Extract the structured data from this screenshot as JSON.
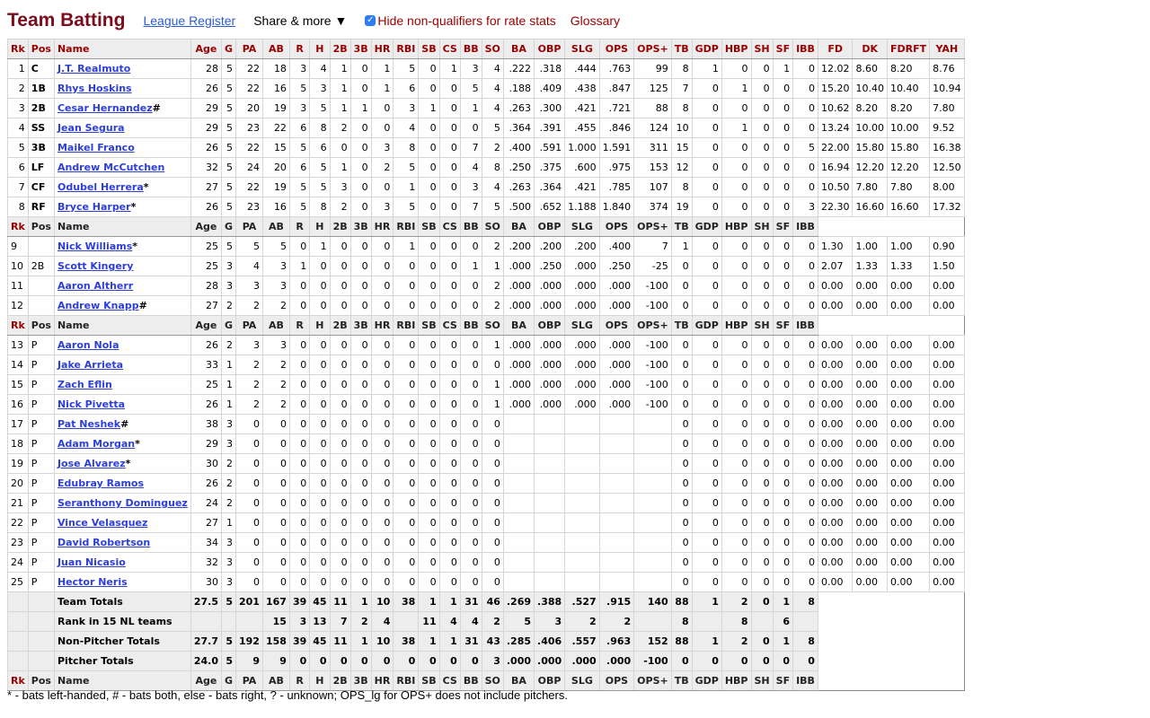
{
  "header": {
    "title": "Team Batting",
    "league_register": "League Register",
    "share_more": "Share & more ▼",
    "hide_nonqualifiers_label": "Hide non-qualifiers for rate stats",
    "hide_nonqualifiers_checked": true,
    "glossary": "Glossary"
  },
  "columns": [
    "Rk",
    "Pos",
    "Name",
    "Age",
    "G",
    "PA",
    "AB",
    "R",
    "H",
    "2B",
    "3B",
    "HR",
    "RBI",
    "SB",
    "CS",
    "BB",
    "SO",
    "BA",
    "OBP",
    "SLG",
    "OPS",
    "OPS+",
    "TB",
    "GDP",
    "HBP",
    "SH",
    "SF",
    "IBB",
    "FD",
    "DK",
    "FDRFT",
    "YAH"
  ],
  "starters": [
    {
      "rk": "1",
      "pos": "C",
      "name": "J.T. Realmuto",
      "mark": "",
      "stats": [
        "28",
        "5",
        "22",
        "18",
        "3",
        "4",
        "1",
        "0",
        "1",
        "5",
        "0",
        "1",
        "3",
        "4",
        ".222",
        ".318",
        ".444",
        ".763",
        "99",
        "8",
        "1",
        "0",
        "0",
        "1",
        "0"
      ],
      "fantasy": [
        "12.02",
        "8.60",
        "8.20",
        "8.76"
      ]
    },
    {
      "rk": "2",
      "pos": "1B",
      "name": "Rhys Hoskins",
      "mark": "",
      "stats": [
        "26",
        "5",
        "22",
        "16",
        "5",
        "3",
        "1",
        "0",
        "1",
        "6",
        "0",
        "0",
        "5",
        "4",
        ".188",
        ".409",
        ".438",
        ".847",
        "125",
        "7",
        "0",
        "1",
        "0",
        "0",
        "0"
      ],
      "fantasy": [
        "15.20",
        "10.40",
        "10.40",
        "10.94"
      ]
    },
    {
      "rk": "3",
      "pos": "2B",
      "name": "Cesar Hernandez",
      "mark": "#",
      "stats": [
        "29",
        "5",
        "20",
        "19",
        "3",
        "5",
        "1",
        "1",
        "0",
        "3",
        "1",
        "0",
        "1",
        "4",
        ".263",
        ".300",
        ".421",
        ".721",
        "88",
        "8",
        "0",
        "0",
        "0",
        "0",
        "0"
      ],
      "fantasy": [
        "10.62",
        "8.20",
        "8.20",
        "7.80"
      ]
    },
    {
      "rk": "4",
      "pos": "SS",
      "name": "Jean Segura",
      "mark": "",
      "stats": [
        "29",
        "5",
        "23",
        "22",
        "6",
        "8",
        "2",
        "0",
        "0",
        "4",
        "0",
        "0",
        "0",
        "5",
        ".364",
        ".391",
        ".455",
        ".846",
        "124",
        "10",
        "0",
        "1",
        "0",
        "0",
        "0"
      ],
      "fantasy": [
        "13.24",
        "10.00",
        "10.00",
        "9.52"
      ]
    },
    {
      "rk": "5",
      "pos": "3B",
      "name": "Maikel Franco",
      "mark": "",
      "stats": [
        "26",
        "5",
        "22",
        "15",
        "5",
        "6",
        "0",
        "0",
        "3",
        "8",
        "0",
        "0",
        "7",
        "2",
        ".400",
        ".591",
        "1.000",
        "1.591",
        "311",
        "15",
        "0",
        "0",
        "0",
        "0",
        "5"
      ],
      "fantasy": [
        "22.00",
        "15.80",
        "15.80",
        "16.38"
      ]
    },
    {
      "rk": "6",
      "pos": "LF",
      "name": "Andrew McCutchen",
      "mark": "",
      "stats": [
        "32",
        "5",
        "24",
        "20",
        "6",
        "5",
        "1",
        "0",
        "2",
        "5",
        "0",
        "0",
        "4",
        "8",
        ".250",
        ".375",
        ".600",
        ".975",
        "153",
        "12",
        "0",
        "0",
        "0",
        "0",
        "0"
      ],
      "fantasy": [
        "16.94",
        "12.20",
        "12.20",
        "12.50"
      ]
    },
    {
      "rk": "7",
      "pos": "CF",
      "name": "Odubel Herrera",
      "mark": "*",
      "stats": [
        "27",
        "5",
        "22",
        "19",
        "5",
        "5",
        "3",
        "0",
        "0",
        "1",
        "0",
        "0",
        "3",
        "4",
        ".263",
        ".364",
        ".421",
        ".785",
        "107",
        "8",
        "0",
        "0",
        "0",
        "0",
        "0"
      ],
      "fantasy": [
        "10.50",
        "7.80",
        "7.80",
        "8.00"
      ]
    },
    {
      "rk": "8",
      "pos": "RF",
      "name": "Bryce Harper",
      "mark": "*",
      "stats": [
        "26",
        "5",
        "23",
        "16",
        "5",
        "8",
        "2",
        "0",
        "3",
        "5",
        "0",
        "0",
        "7",
        "5",
        ".500",
        ".652",
        "1.188",
        "1.840",
        "374",
        "19",
        "0",
        "0",
        "0",
        "0",
        "3"
      ],
      "fantasy": [
        "22.30",
        "16.60",
        "16.60",
        "17.32"
      ]
    }
  ],
  "bench": [
    {
      "rk": "9",
      "pos": "",
      "name": "Nick Williams",
      "mark": "*",
      "stats": [
        "25",
        "5",
        "5",
        "5",
        "0",
        "1",
        "0",
        "0",
        "0",
        "1",
        "0",
        "0",
        "0",
        "2",
        ".200",
        ".200",
        ".200",
        ".400",
        "7",
        "1",
        "0",
        "0",
        "0",
        "0",
        "0"
      ],
      "fantasy": [
        "1.30",
        "1.00",
        "1.00",
        "0.90"
      ]
    },
    {
      "rk": "10",
      "pos": "2B",
      "name": "Scott Kingery",
      "mark": "",
      "stats": [
        "25",
        "3",
        "4",
        "3",
        "1",
        "0",
        "0",
        "0",
        "0",
        "0",
        "0",
        "0",
        "1",
        "1",
        ".000",
        ".250",
        ".000",
        ".250",
        "-25",
        "0",
        "0",
        "0",
        "0",
        "0",
        "0"
      ],
      "fantasy": [
        "2.07",
        "1.33",
        "1.33",
        "1.50"
      ]
    },
    {
      "rk": "11",
      "pos": "",
      "name": "Aaron Altherr",
      "mark": "",
      "stats": [
        "28",
        "3",
        "3",
        "3",
        "0",
        "0",
        "0",
        "0",
        "0",
        "0",
        "0",
        "0",
        "0",
        "2",
        ".000",
        ".000",
        ".000",
        ".000",
        "-100",
        "0",
        "0",
        "0",
        "0",
        "0",
        "0"
      ],
      "fantasy": [
        "0.00",
        "0.00",
        "0.00",
        "0.00"
      ]
    },
    {
      "rk": "12",
      "pos": "",
      "name": "Andrew Knapp",
      "mark": "#",
      "stats": [
        "27",
        "2",
        "2",
        "2",
        "0",
        "0",
        "0",
        "0",
        "0",
        "0",
        "0",
        "0",
        "0",
        "2",
        ".000",
        ".000",
        ".000",
        ".000",
        "-100",
        "0",
        "0",
        "0",
        "0",
        "0",
        "0"
      ],
      "fantasy": [
        "0.00",
        "0.00",
        "0.00",
        "0.00"
      ]
    }
  ],
  "pitchers": [
    {
      "rk": "13",
      "pos": "P",
      "name": "Aaron Nola",
      "mark": "",
      "stats": [
        "26",
        "2",
        "3",
        "3",
        "0",
        "0",
        "0",
        "0",
        "0",
        "0",
        "0",
        "0",
        "0",
        "1",
        ".000",
        ".000",
        ".000",
        ".000",
        "-100",
        "0",
        "0",
        "0",
        "0",
        "0",
        "0"
      ],
      "fantasy": [
        "0.00",
        "0.00",
        "0.00",
        "0.00"
      ]
    },
    {
      "rk": "14",
      "pos": "P",
      "name": "Jake Arrieta",
      "mark": "",
      "stats": [
        "33",
        "1",
        "2",
        "2",
        "0",
        "0",
        "0",
        "0",
        "0",
        "0",
        "0",
        "0",
        "0",
        "0",
        ".000",
        ".000",
        ".000",
        ".000",
        "-100",
        "0",
        "0",
        "0",
        "0",
        "0",
        "0"
      ],
      "fantasy": [
        "0.00",
        "0.00",
        "0.00",
        "0.00"
      ]
    },
    {
      "rk": "15",
      "pos": "P",
      "name": "Zach Eflin",
      "mark": "",
      "stats": [
        "25",
        "1",
        "2",
        "2",
        "0",
        "0",
        "0",
        "0",
        "0",
        "0",
        "0",
        "0",
        "0",
        "1",
        ".000",
        ".000",
        ".000",
        ".000",
        "-100",
        "0",
        "0",
        "0",
        "0",
        "0",
        "0"
      ],
      "fantasy": [
        "0.00",
        "0.00",
        "0.00",
        "0.00"
      ]
    },
    {
      "rk": "16",
      "pos": "P",
      "name": "Nick Pivetta",
      "mark": "",
      "stats": [
        "26",
        "1",
        "2",
        "2",
        "0",
        "0",
        "0",
        "0",
        "0",
        "0",
        "0",
        "0",
        "0",
        "1",
        ".000",
        ".000",
        ".000",
        ".000",
        "-100",
        "0",
        "0",
        "0",
        "0",
        "0",
        "0"
      ],
      "fantasy": [
        "0.00",
        "0.00",
        "0.00",
        "0.00"
      ]
    },
    {
      "rk": "17",
      "pos": "P",
      "name": "Pat Neshek",
      "mark": "#",
      "stats": [
        "38",
        "3",
        "0",
        "0",
        "0",
        "0",
        "0",
        "0",
        "0",
        "0",
        "0",
        "0",
        "0",
        "0",
        "",
        "",
        "",
        "",
        "",
        "0",
        "0",
        "0",
        "0",
        "0",
        "0"
      ],
      "fantasy": [
        "0.00",
        "0.00",
        "0.00",
        "0.00"
      ]
    },
    {
      "rk": "18",
      "pos": "P",
      "name": "Adam Morgan",
      "mark": "*",
      "stats": [
        "29",
        "3",
        "0",
        "0",
        "0",
        "0",
        "0",
        "0",
        "0",
        "0",
        "0",
        "0",
        "0",
        "0",
        "",
        "",
        "",
        "",
        "",
        "0",
        "0",
        "0",
        "0",
        "0",
        "0"
      ],
      "fantasy": [
        "0.00",
        "0.00",
        "0.00",
        "0.00"
      ]
    },
    {
      "rk": "19",
      "pos": "P",
      "name": "Jose Alvarez",
      "mark": "*",
      "stats": [
        "30",
        "2",
        "0",
        "0",
        "0",
        "0",
        "0",
        "0",
        "0",
        "0",
        "0",
        "0",
        "0",
        "0",
        "",
        "",
        "",
        "",
        "",
        "0",
        "0",
        "0",
        "0",
        "0",
        "0"
      ],
      "fantasy": [
        "0.00",
        "0.00",
        "0.00",
        "0.00"
      ]
    },
    {
      "rk": "20",
      "pos": "P",
      "name": "Edubray Ramos",
      "mark": "",
      "stats": [
        "26",
        "2",
        "0",
        "0",
        "0",
        "0",
        "0",
        "0",
        "0",
        "0",
        "0",
        "0",
        "0",
        "0",
        "",
        "",
        "",
        "",
        "",
        "0",
        "0",
        "0",
        "0",
        "0",
        "0"
      ],
      "fantasy": [
        "0.00",
        "0.00",
        "0.00",
        "0.00"
      ]
    },
    {
      "rk": "21",
      "pos": "P",
      "name": "Seranthony Dominguez",
      "mark": "",
      "stats": [
        "24",
        "2",
        "0",
        "0",
        "0",
        "0",
        "0",
        "0",
        "0",
        "0",
        "0",
        "0",
        "0",
        "0",
        "",
        "",
        "",
        "",
        "",
        "0",
        "0",
        "0",
        "0",
        "0",
        "0"
      ],
      "fantasy": [
        "0.00",
        "0.00",
        "0.00",
        "0.00"
      ]
    },
    {
      "rk": "22",
      "pos": "P",
      "name": "Vince Velasquez",
      "mark": "",
      "stats": [
        "27",
        "1",
        "0",
        "0",
        "0",
        "0",
        "0",
        "0",
        "0",
        "0",
        "0",
        "0",
        "0",
        "0",
        "",
        "",
        "",
        "",
        "",
        "0",
        "0",
        "0",
        "0",
        "0",
        "0"
      ],
      "fantasy": [
        "0.00",
        "0.00",
        "0.00",
        "0.00"
      ]
    },
    {
      "rk": "23",
      "pos": "P",
      "name": "David Robertson",
      "mark": "",
      "stats": [
        "34",
        "3",
        "0",
        "0",
        "0",
        "0",
        "0",
        "0",
        "0",
        "0",
        "0",
        "0",
        "0",
        "0",
        "",
        "",
        "",
        "",
        "",
        "0",
        "0",
        "0",
        "0",
        "0",
        "0"
      ],
      "fantasy": [
        "0.00",
        "0.00",
        "0.00",
        "0.00"
      ]
    },
    {
      "rk": "24",
      "pos": "P",
      "name": "Juan Nicasio",
      "mark": "",
      "stats": [
        "32",
        "3",
        "0",
        "0",
        "0",
        "0",
        "0",
        "0",
        "0",
        "0",
        "0",
        "0",
        "0",
        "0",
        "",
        "",
        "",
        "",
        "",
        "0",
        "0",
        "0",
        "0",
        "0",
        "0"
      ],
      "fantasy": [
        "0.00",
        "0.00",
        "0.00",
        "0.00"
      ]
    },
    {
      "rk": "25",
      "pos": "P",
      "name": "Hector Neris",
      "mark": "",
      "stats": [
        "30",
        "3",
        "0",
        "0",
        "0",
        "0",
        "0",
        "0",
        "0",
        "0",
        "0",
        "0",
        "0",
        "0",
        "",
        "",
        "",
        "",
        "",
        "0",
        "0",
        "0",
        "0",
        "0",
        "0"
      ],
      "fantasy": [
        "0.00",
        "0.00",
        "0.00",
        "0.00"
      ]
    }
  ],
  "totals": [
    {
      "label": "Team Totals",
      "stats": [
        "27.5",
        "5",
        "201",
        "167",
        "39",
        "45",
        "11",
        "1",
        "10",
        "38",
        "1",
        "1",
        "31",
        "46",
        ".269",
        ".388",
        ".527",
        ".915",
        "140",
        "88",
        "1",
        "2",
        "0",
        "1",
        "8"
      ]
    },
    {
      "label": "Rank in 15 NL teams",
      "stats": [
        "",
        "",
        "",
        "15",
        "3",
        "13",
        "7",
        "2",
        "4",
        "",
        "11",
        "4",
        "4",
        "2",
        "5",
        "3",
        "2",
        "2",
        "",
        "8",
        "",
        "8",
        "",
        "6",
        ""
      ]
    },
    {
      "label": "Non-Pitcher Totals",
      "stats": [
        "27.7",
        "5",
        "192",
        "158",
        "39",
        "45",
        "11",
        "1",
        "10",
        "38",
        "1",
        "1",
        "31",
        "43",
        ".285",
        ".406",
        ".557",
        ".963",
        "152",
        "88",
        "1",
        "2",
        "0",
        "1",
        "8"
      ]
    },
    {
      "label": "Pitcher Totals",
      "stats": [
        "24.0",
        "5",
        "9",
        "9",
        "0",
        "0",
        "0",
        "0",
        "0",
        "0",
        "0",
        "0",
        "0",
        "3",
        ".000",
        ".000",
        ".000",
        ".000",
        "-100",
        "0",
        "0",
        "0",
        "0",
        "0",
        "0"
      ]
    }
  ],
  "footnote": "* - bats left-handed, # - bats both, else - bats right, ? - unknown; OPS_lg for OPS+ does not include pitchers."
}
